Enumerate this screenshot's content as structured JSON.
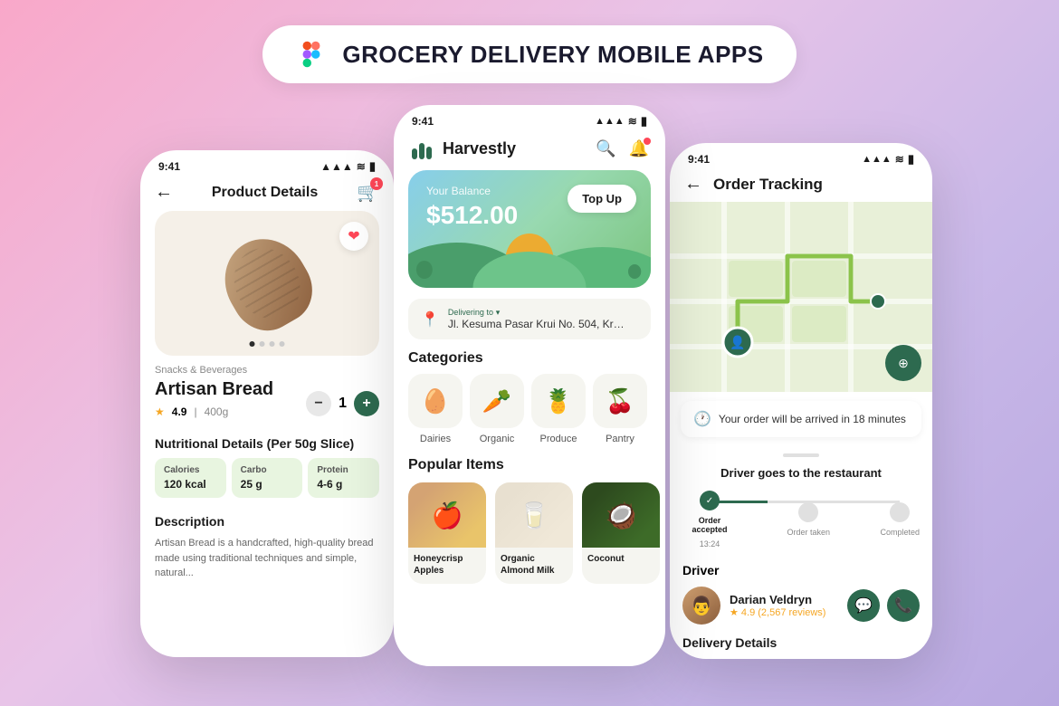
{
  "header": {
    "title": "GROCERY DELIVERY MOBILE APPS",
    "figma_icon": "figma"
  },
  "phone_left": {
    "status_time": "9:41",
    "nav_title": "Product Details",
    "cart_badge": "1",
    "category": "Snacks & Beverages",
    "product_name": "Artisan Bread",
    "rating": "4.9",
    "weight": "400g",
    "quantity": "1",
    "nutrition_title": "Nutritional Details (Per 50g Slice)",
    "nutrition": [
      {
        "label": "Calories",
        "value": "120 kcal"
      },
      {
        "label": "Carbo",
        "value": "25 g"
      },
      {
        "label": "Protein",
        "value": "4-6 g"
      }
    ],
    "description_title": "Description",
    "description_text": "Artisan Bread is a handcrafted, high-quality bread made using traditional techniques and simple, natural..."
  },
  "phone_center": {
    "status_time": "9:41",
    "app_name": "Harvestly",
    "balance_label": "Your Balance",
    "balance_amount": "$512.00",
    "topup_label": "Top Up",
    "delivering_to_label": "Delivering to",
    "delivery_address": "Jl. Kesuma Pasar Krui No. 504, Krui...",
    "categories_title": "Categories",
    "categories": [
      {
        "label": "Dairies",
        "emoji": "🥚"
      },
      {
        "label": "Organic",
        "emoji": "🥕"
      },
      {
        "label": "Produce",
        "emoji": "🍍"
      },
      {
        "label": "Pantry",
        "emoji": "🍒"
      }
    ],
    "popular_title": "Popular Items",
    "popular_items": [
      {
        "name": "Honeycrisp Apples",
        "emoji": "🍎"
      },
      {
        "name": "Organic Almond Milk",
        "emoji": "🥛"
      },
      {
        "name": "Coconut",
        "emoji": "🥥"
      }
    ]
  },
  "phone_right": {
    "status_time": "9:41",
    "nav_title": "Order  Tracking",
    "arrival_text": "Your order will be arrived in 18 minutes",
    "status_text": "Driver goes to the restaurant",
    "steps": [
      {
        "label": "Order accepted",
        "time": "13:24",
        "state": "active"
      },
      {
        "label": "Order taken",
        "time": "",
        "state": "inactive"
      },
      {
        "label": "Completed",
        "time": "",
        "state": "inactive"
      }
    ],
    "driver_section_title": "Driver",
    "driver_name": "Darian Veldryn",
    "driver_rating": "4.9 (2,567 reviews)",
    "delivery_details_title": "Delivery Details"
  }
}
